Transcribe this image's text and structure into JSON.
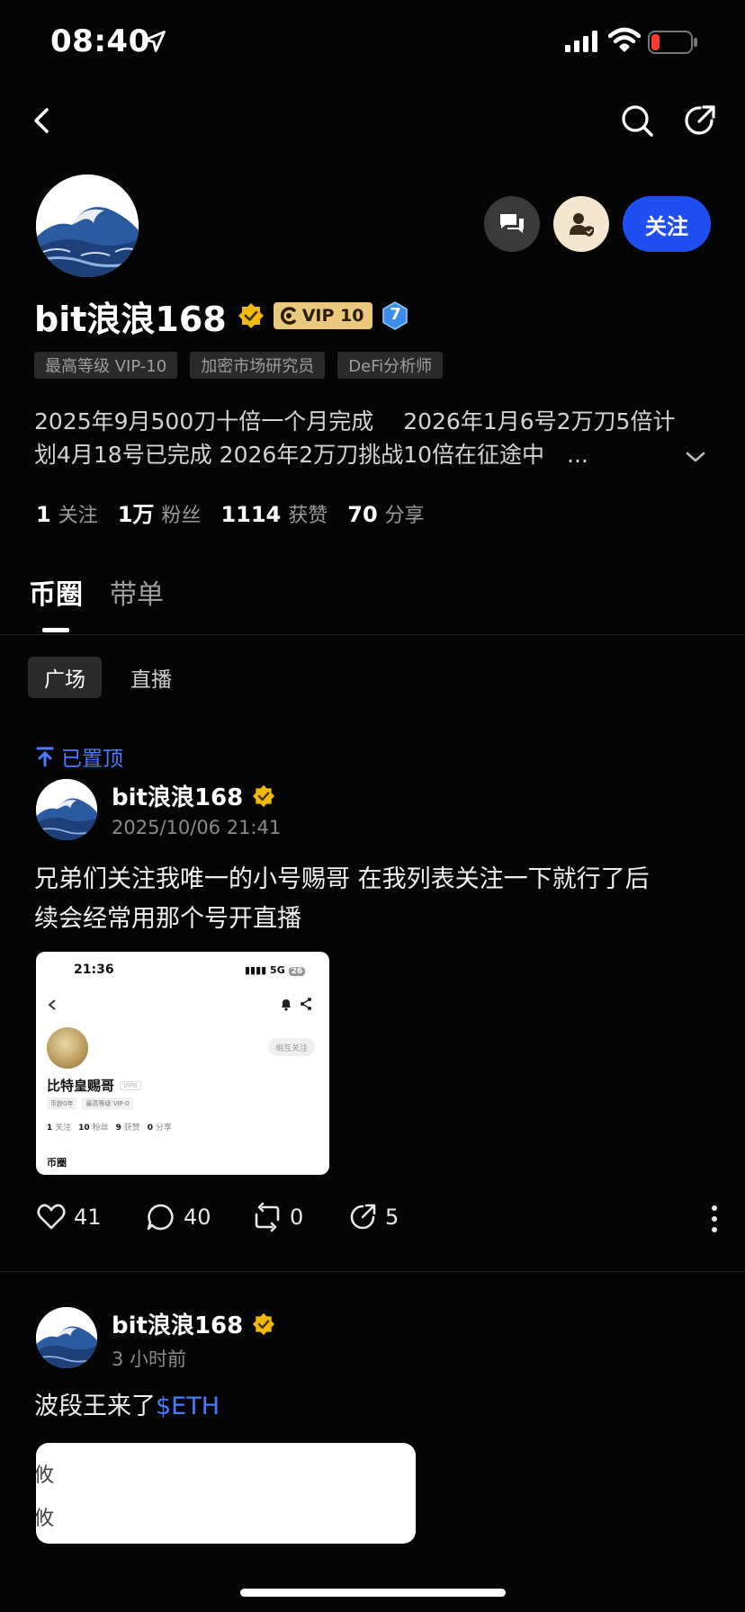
{
  "status_bar": {
    "time": "08:40"
  },
  "profile": {
    "name": "bit浪浪168",
    "vip_label": "VIP 10",
    "level": "7",
    "tags": [
      "最高等级 VIP-10",
      "加密市场研究员",
      "DeFi分析师"
    ],
    "bio_line1": "2025年9月500刀十倍一个月完成　 2026年1月6号2万刀5倍计",
    "bio_line2": "划4月18号已完成 2026年2万刀挑战10倍在征途中　...",
    "follow_label": "关注",
    "stats": [
      {
        "num": "1",
        "label": "关注"
      },
      {
        "num": "1万",
        "label": "粉丝"
      },
      {
        "num": "1114",
        "label": "获赞"
      },
      {
        "num": "70",
        "label": "分享"
      }
    ]
  },
  "tabs": [
    "币圈",
    "带单"
  ],
  "subtabs": [
    "广场",
    "直播"
  ],
  "pinned_label": "已置顶",
  "posts": [
    {
      "author": "bit浪浪168",
      "time": "2025/10/06 21:41",
      "text_line1": "兄弟们关注我唯一的小号赐哥 在我列表关注一下就行了后",
      "text_line2": "续会经常用那个号开直播",
      "likes": "41",
      "comments": "40",
      "reposts": "0",
      "shares": "5",
      "image": {
        "time": "21:36",
        "signal": "5G",
        "battery": "26",
        "mutual_label": "相互关注",
        "name": "比特皇赐哥",
        "vip": "VIP0",
        "tags": [
          "币龄0年",
          "最高等级 VIP-0"
        ],
        "stats": [
          {
            "num": "1",
            "label": "关注"
          },
          {
            "num": "10",
            "label": "粉丝"
          },
          {
            "num": "9",
            "label": "获赞"
          },
          {
            "num": "0",
            "label": "分享"
          }
        ],
        "tab": "币圈"
      }
    },
    {
      "author": "bit浪浪168",
      "time": "3 小时前",
      "text": "波段王来了",
      "cashtag": "$ETH",
      "image_chars": [
        "攸",
        "攸"
      ]
    }
  ]
}
